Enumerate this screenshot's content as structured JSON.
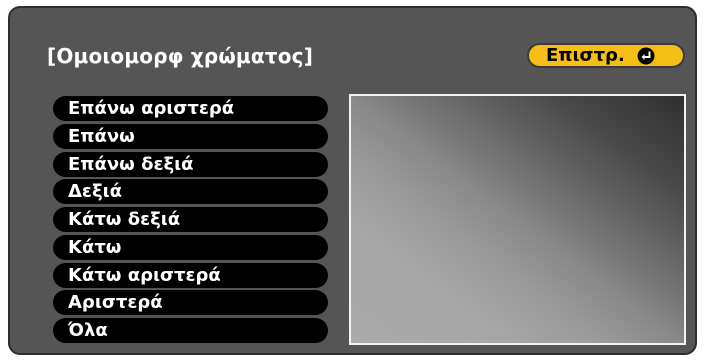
{
  "title": "[Ομοιομορφ χρώματος]",
  "back_button": {
    "label": "Επιστρ.",
    "icon": "enter-icon"
  },
  "menu": {
    "items": [
      {
        "label": "Επάνω αριστερά"
      },
      {
        "label": "Επάνω"
      },
      {
        "label": "Επάνω δεξιά"
      },
      {
        "label": "Δεξιά"
      },
      {
        "label": "Κάτω δεξιά"
      },
      {
        "label": "Κάτω"
      },
      {
        "label": "Κάτω αριστερά"
      },
      {
        "label": "Αριστερά"
      },
      {
        "label": "Όλα"
      }
    ]
  },
  "colors": {
    "panel_background": "#555555",
    "button_accent": "#f5be16",
    "menu_item_background": "#000000",
    "text": "#ffffff"
  }
}
